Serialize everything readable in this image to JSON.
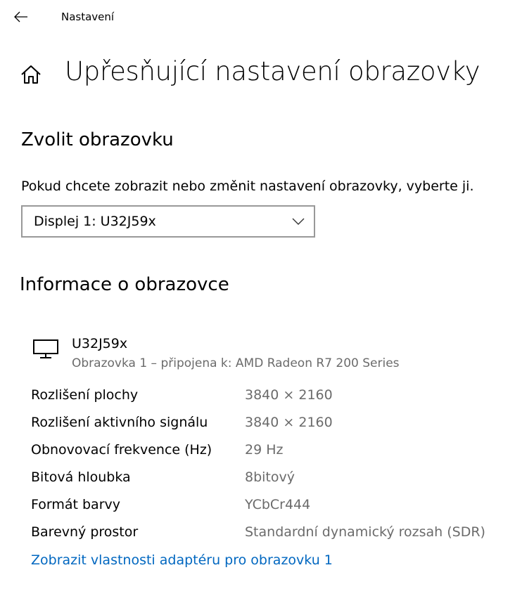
{
  "window": {
    "title": "Nastavení"
  },
  "page": {
    "title": "Upřesňující nastavení obrazovky"
  },
  "select_display": {
    "heading": "Zvolit obrazovku",
    "description": "Pokud chcete zobrazit nebo změnit nastavení obrazovky, vyberte ji.",
    "dropdown_value": "Displej 1: U32J59x"
  },
  "display_info": {
    "heading": "Informace o obrazovce",
    "name": "U32J59x",
    "subtitle": "Obrazovka 1 – připojena k: AMD Radeon R7 200 Series",
    "rows": [
      {
        "label": "Rozlišení plochy",
        "value": "3840 × 2160"
      },
      {
        "label": "Rozlišení aktivního signálu",
        "value": "3840 × 2160"
      },
      {
        "label": "Obnovovací frekvence (Hz)",
        "value": "29 Hz"
      },
      {
        "label": "Bitová hloubka",
        "value": "8bitový"
      },
      {
        "label": "Formát barvy",
        "value": "YCbCr444"
      },
      {
        "label": "Barevný prostor",
        "value": "Standardní dynamický rozsah (SDR)"
      }
    ],
    "adapter_link": "Zobrazit vlastnosti adaptéru pro obrazovku 1"
  },
  "icons": {
    "back": "back-arrow-icon",
    "home": "home-icon",
    "chevron": "chevron-down-icon",
    "monitor": "monitor-icon"
  },
  "colors": {
    "link": "#0067c0",
    "secondary_text": "#6b6b6b",
    "dropdown_border": "#999999"
  }
}
